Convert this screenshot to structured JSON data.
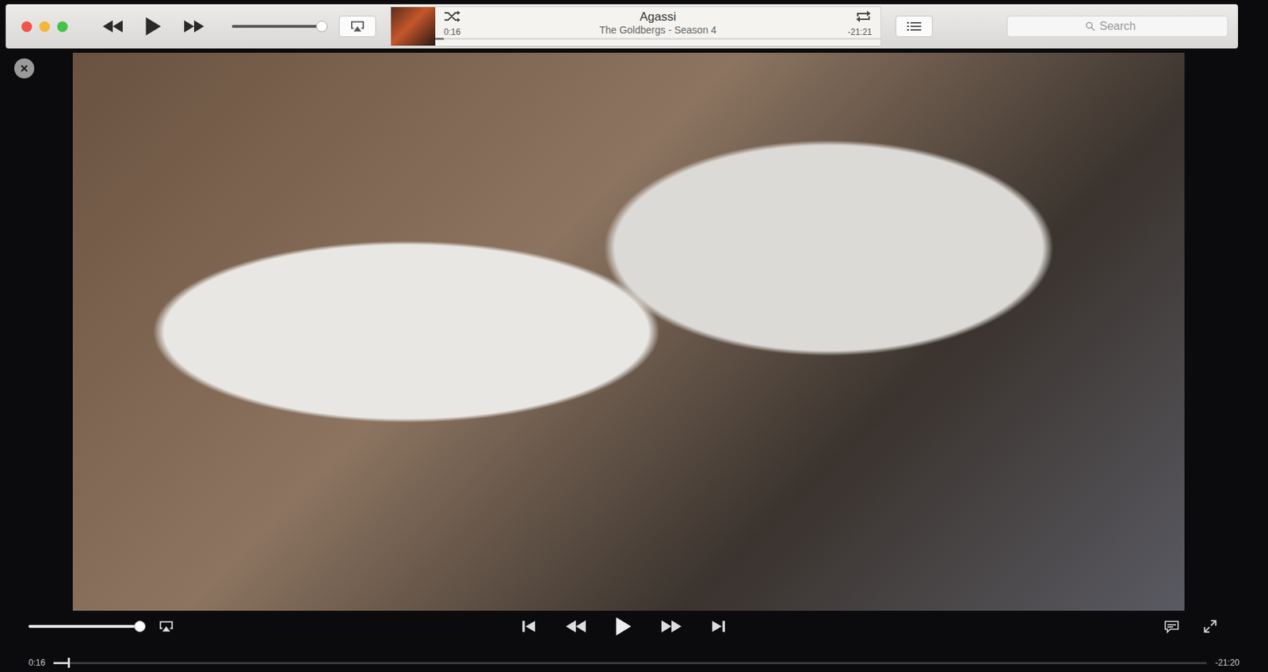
{
  "toolbar": {
    "volume": {
      "level": 0.97
    },
    "now_playing": {
      "title": "Agassi",
      "subtitle": "The Goldbergs - Season 4",
      "elapsed": "0:16",
      "remaining": "-21:21",
      "progress": 0.02
    },
    "search": {
      "placeholder": "Search"
    }
  },
  "controls": {
    "volume": {
      "level": 1.0
    },
    "elapsed": "0:16",
    "remaining": "-21:20",
    "progress": 0.013
  }
}
